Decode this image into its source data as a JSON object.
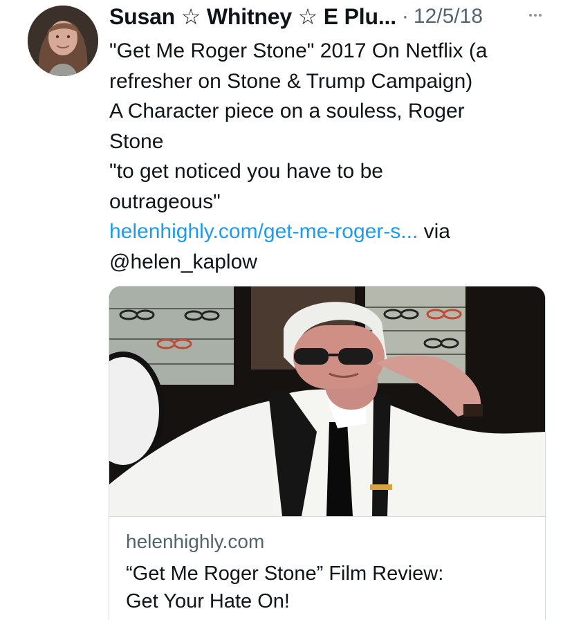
{
  "tweet": {
    "author_name": "Susan ☆ Whitney ☆ E Plu...",
    "separator": "·",
    "date": "12/5/18",
    "text_lines": [
      "\"Get Me Roger Stone\" 2017 On Netflix (a",
      "refresher on Stone & Trump Campaign)",
      "A Character piece on a souless, Roger",
      "Stone",
      "\"to get noticed you have to be",
      "outrageous\""
    ],
    "link_text": "helenhighly.com/get-me-roger-s...",
    "via_text": " via",
    "mention": "@helen_kaplow"
  },
  "card": {
    "domain": "helenhighly.com",
    "title_lines": [
      "“Get Me Roger Stone” Film Review:",
      "Get Your Hate On!"
    ]
  },
  "colors": {
    "text": "#0f1419",
    "secondary": "#536471",
    "link": "#1d9bf0",
    "border": "#cfd9de"
  },
  "icons": {
    "more": "more-horizontal-icon"
  }
}
